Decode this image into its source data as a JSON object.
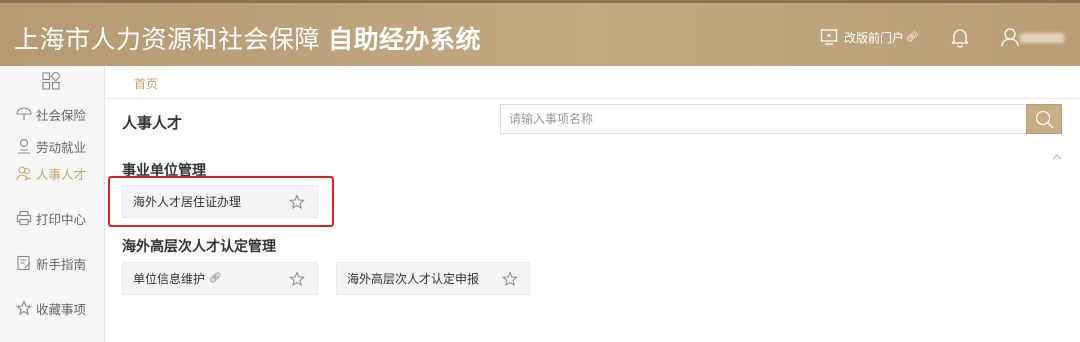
{
  "header": {
    "title_main": "上海市人力资源和社会保障",
    "title_bold": "自助经办系统",
    "portal_link": "改版前门户",
    "portal_link_icon": "link-icon"
  },
  "sidebar": {
    "items": [
      {
        "label": "社会保险",
        "icon": "umbrella-icon"
      },
      {
        "label": "劳动就业",
        "icon": "worker-icon"
      },
      {
        "label": "人事人才",
        "icon": "people-icon",
        "active": true
      },
      {
        "label": "打印中心",
        "icon": "printer-icon"
      },
      {
        "label": "新手指南",
        "icon": "guide-icon"
      },
      {
        "label": "收藏事项",
        "icon": "star-icon"
      }
    ]
  },
  "breadcrumb": "首页",
  "section": {
    "title": "人事人才",
    "search_placeholder": "请输入事项名称"
  },
  "groups": [
    {
      "title": "事业单位管理",
      "items": [
        {
          "label": "海外人才居住证办理",
          "highlighted": true
        }
      ]
    },
    {
      "title": "海外高层次人才认定管理",
      "items": [
        {
          "label": "单位信息维护",
          "link_icon": true
        },
        {
          "label": "海外高层次人才认定申报"
        }
      ]
    }
  ],
  "colors": {
    "header_bg": "#bea47c",
    "accent": "#c9a46a",
    "highlight_border": "#e0231f",
    "search_button": "#c8ad85"
  }
}
